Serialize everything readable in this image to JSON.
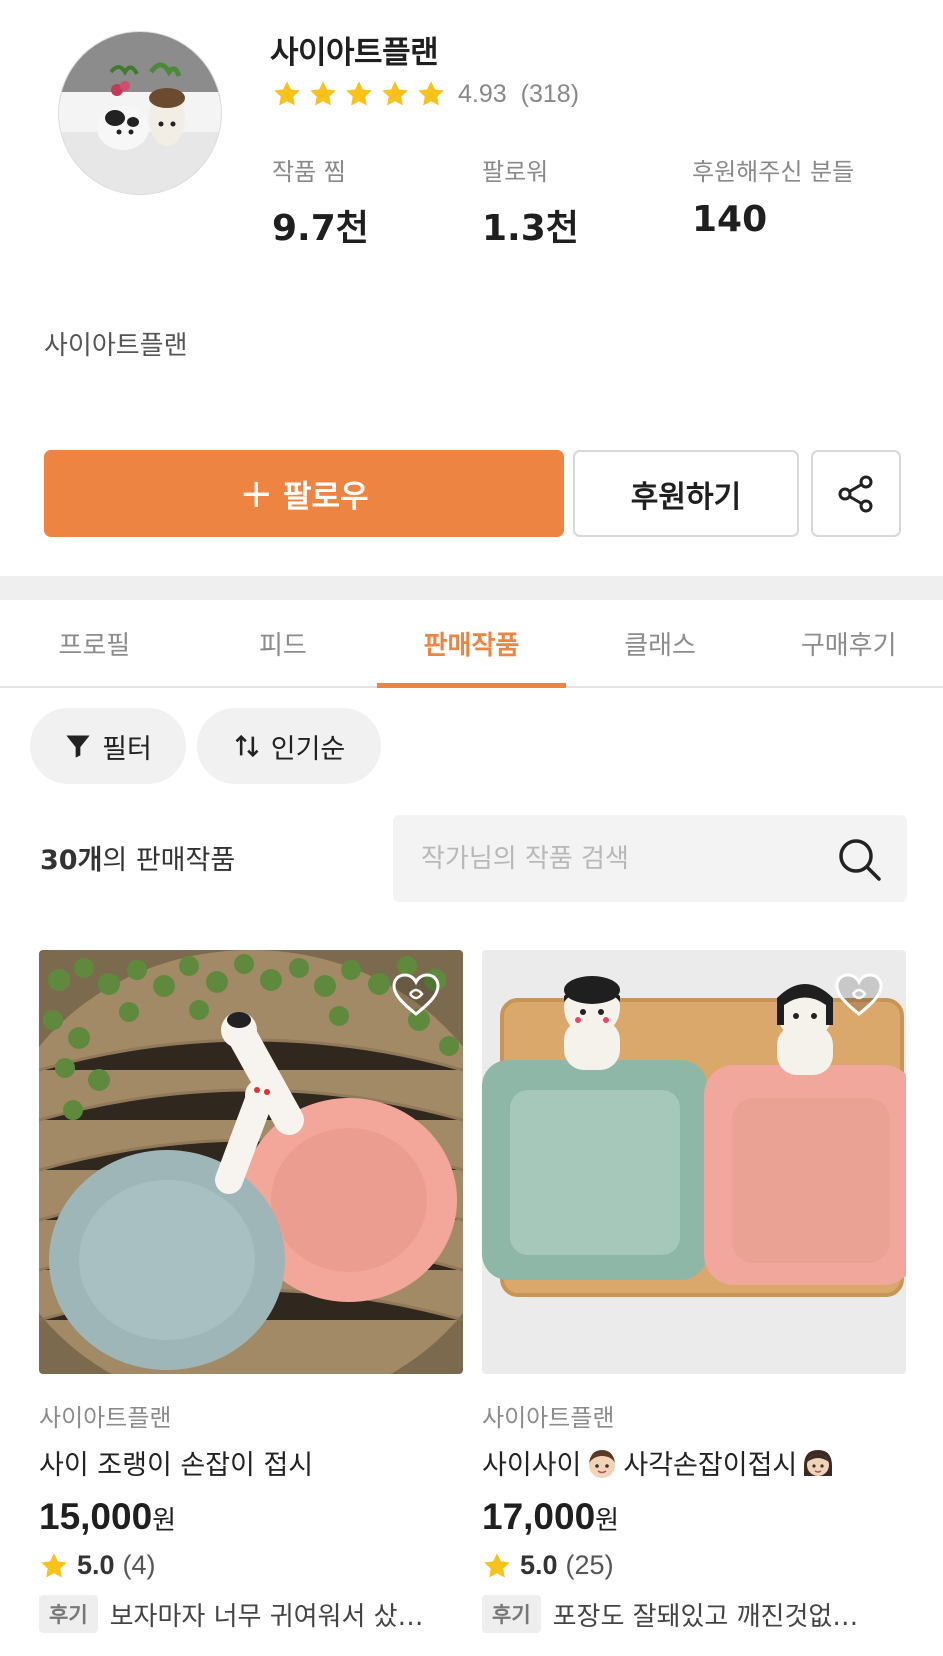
{
  "profile": {
    "shop_name": "사이아트플랜",
    "rating": "4.93",
    "rating_count": "(318)",
    "stats": [
      {
        "label": "작품 찜",
        "value": "9.7천"
      },
      {
        "label": "팔로워",
        "value": "1.3천"
      },
      {
        "label": "후원해주신 분들",
        "value": "140"
      }
    ],
    "bio": "사이아트플랜"
  },
  "actions": {
    "follow_plus": "+",
    "follow_label": "팔로우",
    "sponsor_label": "후원하기",
    "share_icon": "share-icon"
  },
  "tabs": [
    {
      "label": "프로필",
      "active": false
    },
    {
      "label": "피드",
      "active": false
    },
    {
      "label": "판매작품",
      "active": true
    },
    {
      "label": "클래스",
      "active": false
    },
    {
      "label": "구매후기",
      "active": false
    }
  ],
  "filters": {
    "filter_label": "필터",
    "sort_label": "인기순"
  },
  "listing": {
    "count_number": "30개",
    "count_suffix": "의 판매작품",
    "search_placeholder": "작가님의 작품 검색"
  },
  "products": [
    {
      "shop": "사이아트플랜",
      "title": "사이 조랭이 손잡이 접시",
      "price": "15,000",
      "currency": "원",
      "score": "5.0",
      "review_count": "(4)",
      "review_badge": "후기",
      "review_text": "보자마자 너무 귀여워서 샀…"
    },
    {
      "shop": "사이아트플랜",
      "title_part1": "사이사이 ",
      "title_part2": "사각손잡이접시",
      "price": "17,000",
      "currency": "원",
      "score": "5.0",
      "review_count": "(25)",
      "review_badge": "후기",
      "review_text": "포장도 잘돼있고 깨진것없…"
    }
  ],
  "colors": {
    "accent": "#ee8442",
    "star": "#f8c21a"
  }
}
